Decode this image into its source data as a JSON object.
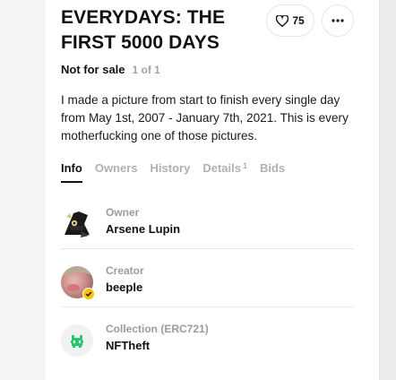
{
  "artwork": {
    "title": "EVERYDAYS: THE FIRST 5000 DAYS",
    "likes": "75",
    "sale_status": "Not for sale",
    "edition": "1 of 1",
    "description": "I made a picture from start to finish every single day from May 1st, 2007 - January 7th, 2021.  This is every motherfucking one of those pictures."
  },
  "tabs": [
    {
      "label": "Info",
      "active": true
    },
    {
      "label": "Owners"
    },
    {
      "label": "History"
    },
    {
      "label": "Details",
      "count": "1"
    },
    {
      "label": "Bids"
    }
  ],
  "info": {
    "owner": {
      "role": "Owner",
      "name": "Arsene Lupin",
      "icon": "top-hat-avatar"
    },
    "creator": {
      "role": "Creator",
      "name": "beeple",
      "icon": "creator-avatar",
      "verified": true
    },
    "collection": {
      "role": "Collection (ERC721)",
      "name": "NFTheft",
      "icon": "green-invader-logo"
    }
  },
  "colors": {
    "accent_verified": "#f5c400",
    "collection_green": "#29c86e",
    "muted_text": "#a3a3a3"
  }
}
